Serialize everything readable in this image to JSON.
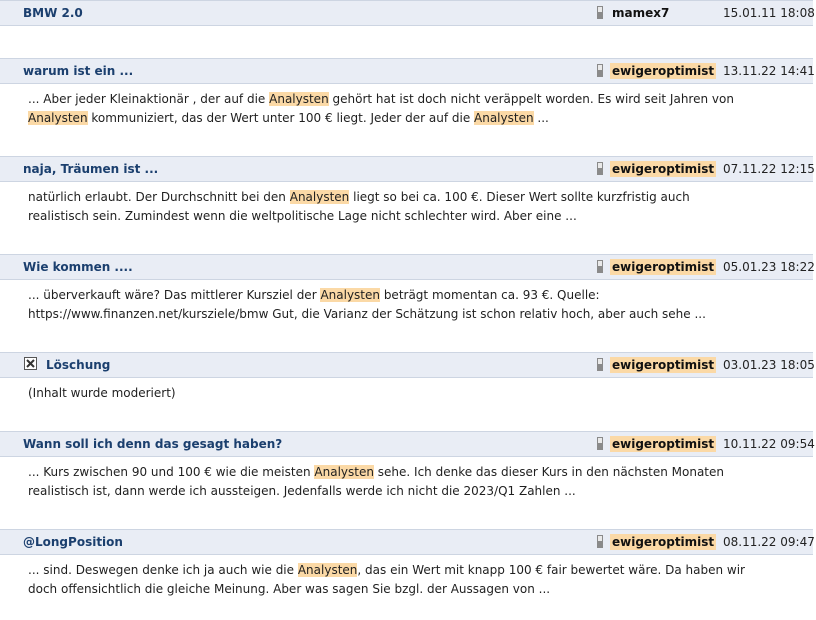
{
  "accent_color": "#1b3f6e",
  "highlight_color": "#fbd9a6",
  "header_bg": "#e9edf5",
  "posts": [
    {
      "title": "BMW 2.0",
      "user": "mamex7",
      "date": "15.01.11 18:08",
      "body": []
    },
    {
      "title": "warum ist ein ...",
      "user": "ewigeroptimist",
      "date": "13.11.22 14:41",
      "body": [
        [
          {
            "t": "... Aber jeder Kleinaktionär , der auf die "
          },
          {
            "t": "Analysten",
            "hl": true
          },
          {
            "t": " gehört hat ist doch nicht veräppelt worden. Es wird seit Jahren von"
          }
        ],
        [
          {
            "t": "Analysten",
            "hl": true
          },
          {
            "t": " kommuniziert, das der Wert unter 100 € liegt. Jeder der auf die "
          },
          {
            "t": "Analysten",
            "hl": true
          },
          {
            "t": " ..."
          }
        ]
      ]
    },
    {
      "title": "naja, Träumen ist ...",
      "user": "ewigeroptimist",
      "date": "07.11.22 12:15",
      "body": [
        [
          {
            "t": "natürlich erlaubt. Der Durchschnitt bei den "
          },
          {
            "t": "Analysten",
            "hl": true
          },
          {
            "t": " liegt so bei ca. 100 €. Dieser Wert sollte kurzfristig auch"
          }
        ],
        [
          {
            "t": "realistisch sein. Zumindest wenn die weltpolitische Lage nicht schlechter wird. Aber eine ..."
          }
        ]
      ]
    },
    {
      "title": "Wie kommen ....",
      "user": "ewigeroptimist",
      "date": "05.01.23 18:22",
      "body": [
        [
          {
            "t": "... überverkauft wäre? Das mittlerer Kursziel der "
          },
          {
            "t": "Analysten",
            "hl": true
          },
          {
            "t": " beträgt momentan ca. 93 €. Quelle:"
          }
        ],
        [
          {
            "t": "https://www.finanzen.net/kursziele/bmw Gut, die Varianz der Schätzung ist schon relativ hoch, aber auch sehe ..."
          }
        ]
      ]
    },
    {
      "title": "Löschung",
      "user": "ewigeroptimist",
      "date": "03.01.23 18:05",
      "deleted": true,
      "body": [
        [
          {
            "t": "(Inhalt wurde moderiert)"
          }
        ]
      ]
    },
    {
      "title": "Wann soll ich denn das gesagt haben?",
      "user": "ewigeroptimist",
      "date": "10.11.22 09:54",
      "body": [
        [
          {
            "t": "... Kurs zwischen 90 und 100 € wie die meisten "
          },
          {
            "t": "Analysten",
            "hl": true
          },
          {
            "t": " sehe. Ich denke das dieser Kurs in den nächsten Monaten"
          }
        ],
        [
          {
            "t": "realistisch ist, dann werde ich aussteigen. Jedenfalls werde ich nicht die 2023/Q1 Zahlen ..."
          }
        ]
      ]
    },
    {
      "title": "@LongPosition",
      "user": "ewigeroptimist",
      "date": "08.11.22 09:47",
      "body": [
        [
          {
            "t": "... sind. Deswegen denke ich ja auch wie die "
          },
          {
            "t": "Analysten",
            "hl": true
          },
          {
            "t": ", das ein Wert mit knapp 100 € fair bewertet wäre. Da haben wir"
          }
        ],
        [
          {
            "t": "doch offensichtlich die gleiche Meinung. Aber was sagen Sie bzgl. der Aussagen von ..."
          }
        ]
      ]
    }
  ]
}
